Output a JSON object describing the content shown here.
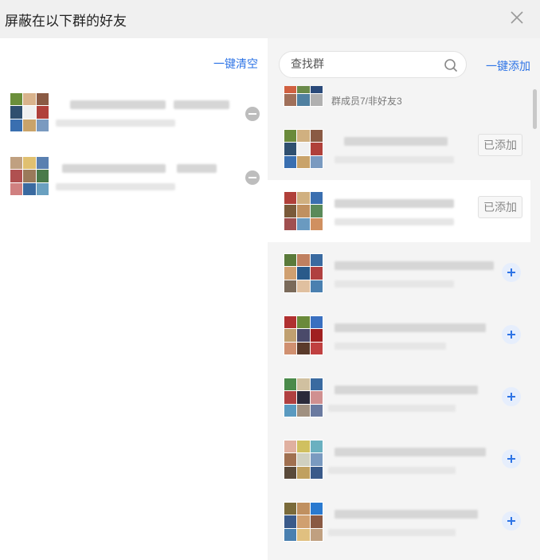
{
  "dialog": {
    "title": "屏蔽在以下群的好友"
  },
  "left": {
    "clear_all_label": "一键清空"
  },
  "right": {
    "search_placeholder": "查找群",
    "add_all_label": "一键添加",
    "top_item_sub": "群成员7/非好友3",
    "added_label": "已添加"
  },
  "colors": {
    "accent": "#2e74e6",
    "panel_bg": "#f4f4f4",
    "title_bg": "#f0f0f0"
  }
}
